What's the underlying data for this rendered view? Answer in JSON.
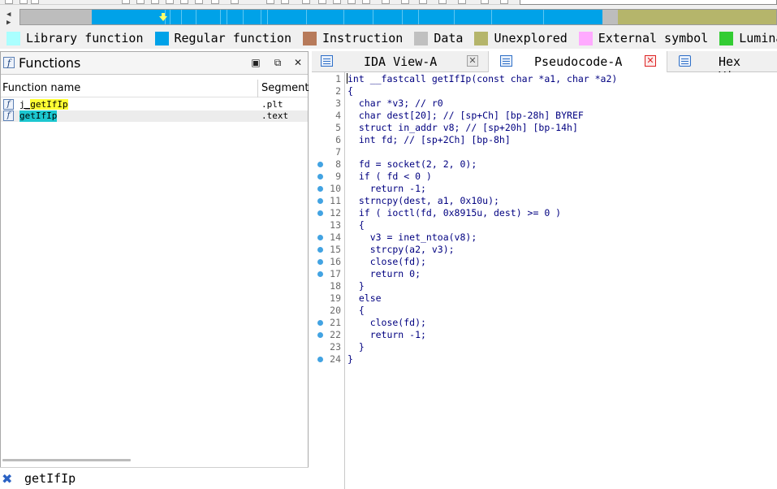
{
  "legend": [
    {
      "label": "Library function",
      "color": "#aaffff"
    },
    {
      "label": "Regular function",
      "color": "#00a2e8"
    },
    {
      "label": "Instruction",
      "color": "#b77a5a"
    },
    {
      "label": "Data",
      "color": "#c0c0c0"
    },
    {
      "label": "Unexplored",
      "color": "#b5b56b"
    },
    {
      "label": "External symbol",
      "color": "#ffaaff"
    },
    {
      "label": "Lumina func",
      "color": "#33cc33"
    }
  ],
  "functions_panel": {
    "title": "Functions",
    "columns": {
      "name": "Function name",
      "segment": "Segment"
    },
    "rows": [
      {
        "name": "j_getIfIp",
        "segment": ".plt"
      },
      {
        "name": "getIfIp",
        "segment": ".text"
      }
    ]
  },
  "filter": {
    "text": "getIfIp"
  },
  "tabs": [
    {
      "label": "IDA View-A"
    },
    {
      "label": "Pseudocode-A"
    },
    {
      "label": "Hex View"
    }
  ],
  "code": {
    "lines": [
      {
        "n": "1",
        "text": "int __fastcall getIfIp(const char *a1, char *a2)",
        "bp": false
      },
      {
        "n": "2",
        "text": "{",
        "bp": false
      },
      {
        "n": "3",
        "text": "  char *v3; // r0",
        "bp": false
      },
      {
        "n": "4",
        "text": "  char dest[20]; // [sp+Ch] [bp-28h] BYREF",
        "bp": false
      },
      {
        "n": "5",
        "text": "  struct in_addr v8; // [sp+20h] [bp-14h]",
        "bp": false
      },
      {
        "n": "6",
        "text": "  int fd; // [sp+2Ch] [bp-8h]",
        "bp": false
      },
      {
        "n": "7",
        "text": "",
        "bp": false
      },
      {
        "n": "8",
        "text": "  fd = socket(2, 2, 0);",
        "bp": true
      },
      {
        "n": "9",
        "text": "  if ( fd < 0 )",
        "bp": true
      },
      {
        "n": "10",
        "text": "    return -1;",
        "bp": true
      },
      {
        "n": "11",
        "text": "  strncpy(dest, a1, 0x10u);",
        "bp": true
      },
      {
        "n": "12",
        "text": "  if ( ioctl(fd, 0x8915u, dest) >= 0 )",
        "bp": true
      },
      {
        "n": "13",
        "text": "  {",
        "bp": false
      },
      {
        "n": "14",
        "text": "    v3 = inet_ntoa(v8);",
        "bp": true
      },
      {
        "n": "15",
        "text": "    strcpy(a2, v3);",
        "bp": true
      },
      {
        "n": "16",
        "text": "    close(fd);",
        "bp": true
      },
      {
        "n": "17",
        "text": "    return 0;",
        "bp": true
      },
      {
        "n": "18",
        "text": "  }",
        "bp": false
      },
      {
        "n": "19",
        "text": "  else",
        "bp": false
      },
      {
        "n": "20",
        "text": "  {",
        "bp": false
      },
      {
        "n": "21",
        "text": "    close(fd);",
        "bp": true
      },
      {
        "n": "22",
        "text": "    return -1;",
        "bp": true
      },
      {
        "n": "23",
        "text": "  }",
        "bp": false
      },
      {
        "n": "24",
        "text": "}",
        "bp": true
      }
    ]
  }
}
